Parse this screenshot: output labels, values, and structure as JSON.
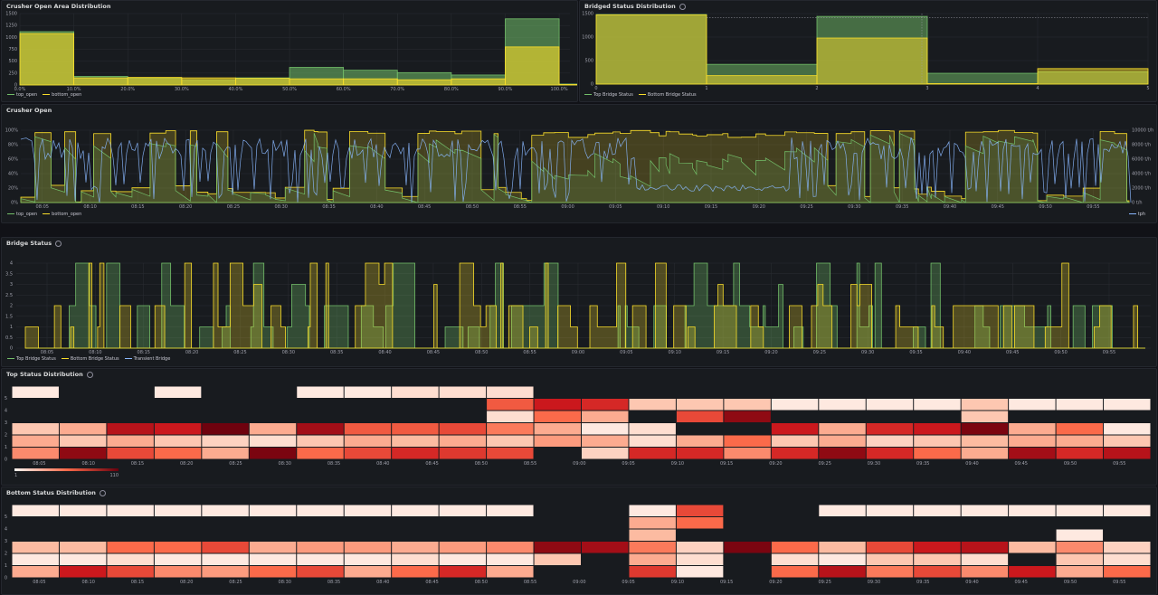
{
  "colors": {
    "green": "#73bf69",
    "yellow": "#fade2a",
    "blue": "#8ab8ff",
    "grid": "#2a2d33",
    "heat_low": "#fff5f0",
    "heat_high": "#67000d"
  },
  "panels": {
    "crusher_area": {
      "title": "Crusher Open Area Distribution"
    },
    "bridged_dist": {
      "title": "Bridged Status Distribution"
    },
    "crusher_open": {
      "title": "Crusher Open"
    },
    "bridge_status": {
      "title": "Bridge Status"
    },
    "top_dist": {
      "title": "Top Status Distribution"
    },
    "bottom_dist": {
      "title": "Bottom Status Distribution"
    }
  },
  "legends": {
    "crusher_area": [
      {
        "label": "top_open",
        "color": "#73bf69"
      },
      {
        "label": "bottom_open",
        "color": "#fade2a"
      }
    ],
    "bridged_dist": [
      {
        "label": "Top Bridge Status",
        "color": "#73bf69"
      },
      {
        "label": "Bottom Bridge Status",
        "color": "#fade2a"
      }
    ],
    "crusher_open_left": [
      {
        "label": "top_open",
        "color": "#73bf69"
      },
      {
        "label": "bottom_open",
        "color": "#fade2a"
      }
    ],
    "crusher_open_right": [
      {
        "label": "tph",
        "color": "#8ab8ff"
      }
    ],
    "bridge_status": [
      {
        "label": "Top Bridge Status",
        "color": "#73bf69"
      },
      {
        "label": "Bottom Bridge Status",
        "color": "#fade2a"
      },
      {
        "label": "Transient Bridge",
        "color": "#8ab8ff"
      }
    ]
  },
  "time_ticks": [
    "08:05",
    "08:10",
    "08:15",
    "08:20",
    "08:25",
    "08:30",
    "08:35",
    "08:40",
    "08:45",
    "08:50",
    "08:55",
    "09:00",
    "09:05",
    "09:10",
    "09:15",
    "09:20",
    "09:25",
    "09:30",
    "09:35",
    "09:40",
    "09:45",
    "09:50",
    "09:55"
  ],
  "heat_scale": {
    "min": "1",
    "max": "110"
  },
  "chart_data": [
    {
      "type": "bar",
      "title": "Crusher Open Area Distribution",
      "categories": [
        "0.0%",
        "10.0%",
        "20.0%",
        "30.0%",
        "40.0%",
        "50.0%",
        "60.0%",
        "70.0%",
        "80.0%",
        "90.0%",
        "100.0%"
      ],
      "x_tick_labels": [
        "0.0%",
        "10.0%",
        "20.0%",
        "30.0%",
        "40.0%",
        "50.0%",
        "60.0%",
        "70.0%",
        "80.0%",
        "90.0%",
        "100.0%"
      ],
      "y_tick_labels": [
        "0",
        "250",
        "500",
        "750",
        "1000",
        "1250",
        "1500"
      ],
      "ylim": [
        0,
        1500
      ],
      "series": [
        {
          "name": "top_open",
          "values": [
            1120,
            180,
            140,
            100,
            150,
            370,
            310,
            260,
            210,
            1390,
            20
          ]
        },
        {
          "name": "bottom_open",
          "values": [
            1080,
            150,
            160,
            150,
            140,
            130,
            130,
            110,
            130,
            800,
            10
          ]
        }
      ]
    },
    {
      "type": "bar",
      "title": "Bridged Status Distribution",
      "categories": [
        "0",
        "1",
        "2",
        "3",
        "4",
        "5"
      ],
      "x_tick_labels": [
        "0",
        "1",
        "2",
        "3",
        "4",
        "5"
      ],
      "y_tick_labels": [
        "0",
        "500",
        "1000",
        "1500"
      ],
      "ylim": [
        0,
        1500
      ],
      "series": [
        {
          "name": "Top Bridge Status",
          "values": [
            1480,
            420,
            1440,
            230,
            260
          ]
        },
        {
          "name": "Bottom Bridge Status",
          "values": [
            1470,
            180,
            980,
            10,
            330
          ]
        }
      ]
    },
    {
      "type": "line",
      "title": "Crusher Open",
      "left_axis_ticks": [
        "0%",
        "20%",
        "40%",
        "60%",
        "80%",
        "100%"
      ],
      "right_axis_ticks": [
        "0 t/h",
        "2000 t/h",
        "4000 t/h",
        "6000 t/h",
        "8000 t/h",
        "10000 t/h"
      ],
      "x_range": [
        "08:01",
        "09:59"
      ],
      "series": [
        {
          "name": "top_open",
          "axis": "left"
        },
        {
          "name": "bottom_open",
          "axis": "left"
        },
        {
          "name": "tph",
          "axis": "right"
        }
      ]
    },
    {
      "type": "line",
      "title": "Bridge Status",
      "y_tick_labels": [
        "0",
        "0.5",
        "1",
        "1.5",
        "2",
        "2.5",
        "3",
        "3.5",
        "4"
      ],
      "ylim": [
        0,
        4
      ],
      "series": [
        {
          "name": "Top Bridge Status"
        },
        {
          "name": "Bottom Bridge Status"
        },
        {
          "name": "Transient Bridge"
        }
      ]
    },
    {
      "type": "heatmap",
      "title": "Top Status Distribution",
      "y_tick_labels": [
        "0",
        "1",
        "2",
        "3",
        "4",
        "5"
      ],
      "rows": [
        [
          0.4,
          0.9,
          0.6,
          0.5,
          0.3,
          0.95,
          0.5,
          0.6,
          0.7,
          0.65,
          0.6,
          0,
          0.15,
          0.7,
          0.7,
          0.4,
          0.7,
          0.9,
          0.7,
          0.5,
          0.3,
          0.85,
          0.7,
          0.8
        ],
        [
          0.3,
          0.2,
          0.3,
          0.2,
          0.15,
          0.1,
          0.2,
          0.3,
          0.25,
          0.3,
          0.2,
          0.35,
          0.3,
          0.1,
          0.3,
          0.5,
          0.2,
          0.3,
          0.15,
          0.2,
          0.25,
          0.3,
          0.3,
          0.2
        ],
        [
          0.2,
          0.3,
          0.8,
          0.75,
          0.98,
          0.3,
          0.85,
          0.55,
          0.55,
          0.6,
          0.45,
          0.3,
          0.05,
          0.1,
          0,
          0,
          0.75,
          0.3,
          0.7,
          0.75,
          0.95,
          0.3,
          0.5,
          0.05
        ],
        [
          0,
          0,
          0,
          0,
          0,
          0,
          0,
          0,
          0,
          0,
          0.1,
          0.5,
          0.3,
          0,
          0.6,
          0.9,
          0,
          0,
          0,
          0,
          0.2,
          0,
          0,
          0
        ],
        [
          0,
          0,
          0,
          0,
          0,
          0,
          0,
          0,
          0,
          0,
          0.55,
          0.75,
          0.7,
          0.2,
          0.2,
          0.2,
          0.05,
          0.05,
          0.05,
          0.05,
          0.2,
          0.05,
          0.05,
          0.05
        ],
        [
          0.05,
          0,
          0,
          0.05,
          0,
          0,
          0.05,
          0.05,
          0.1,
          0.1,
          0.1,
          0,
          0,
          0,
          0,
          0,
          0,
          0,
          0,
          0,
          0,
          0,
          0,
          0
        ]
      ]
    },
    {
      "type": "heatmap",
      "title": "Bottom Status Distribution",
      "y_tick_labels": [
        "0",
        "1",
        "2",
        "3",
        "4",
        "5"
      ],
      "rows": [
        [
          0.3,
          0.75,
          0.6,
          0.4,
          0.35,
          0.5,
          0.6,
          0.3,
          0.5,
          0.7,
          0.3,
          0,
          0,
          0.65,
          0.05,
          0,
          0.5,
          0.8,
          0.45,
          0.6,
          0.4,
          0.75,
          0.3,
          0.5
        ],
        [
          0.05,
          0.05,
          0.1,
          0.05,
          0.05,
          0.05,
          0.05,
          0.05,
          0.1,
          0.05,
          0.05,
          0.2,
          0,
          0.3,
          0.1,
          0,
          0.1,
          0.05,
          0.2,
          0.2,
          0.1,
          0,
          0.2,
          0.1
        ],
        [
          0.25,
          0.25,
          0.5,
          0.5,
          0.6,
          0.3,
          0.35,
          0.35,
          0.3,
          0.35,
          0.4,
          0.9,
          0.85,
          0.45,
          0.15,
          0.95,
          0.5,
          0.25,
          0.6,
          0.75,
          0.8,
          0.25,
          0.4,
          0.15
        ],
        [
          0,
          0,
          0,
          0,
          0,
          0,
          0,
          0,
          0,
          0,
          0,
          0,
          0,
          0.25,
          0,
          0,
          0,
          0,
          0,
          0,
          0,
          0,
          0.05,
          0
        ],
        [
          0,
          0,
          0,
          0,
          0,
          0,
          0,
          0,
          0,
          0,
          0,
          0,
          0,
          0.3,
          0.5,
          0,
          0,
          0,
          0,
          0,
          0,
          0,
          0,
          0
        ],
        [
          0.05,
          0.05,
          0.05,
          0.05,
          0.05,
          0.05,
          0.05,
          0.05,
          0.05,
          0.05,
          0.05,
          0,
          0,
          0.05,
          0.6,
          0,
          0,
          0.05,
          0.05,
          0.05,
          0.05,
          0.05,
          0.05,
          0.05
        ]
      ]
    }
  ]
}
